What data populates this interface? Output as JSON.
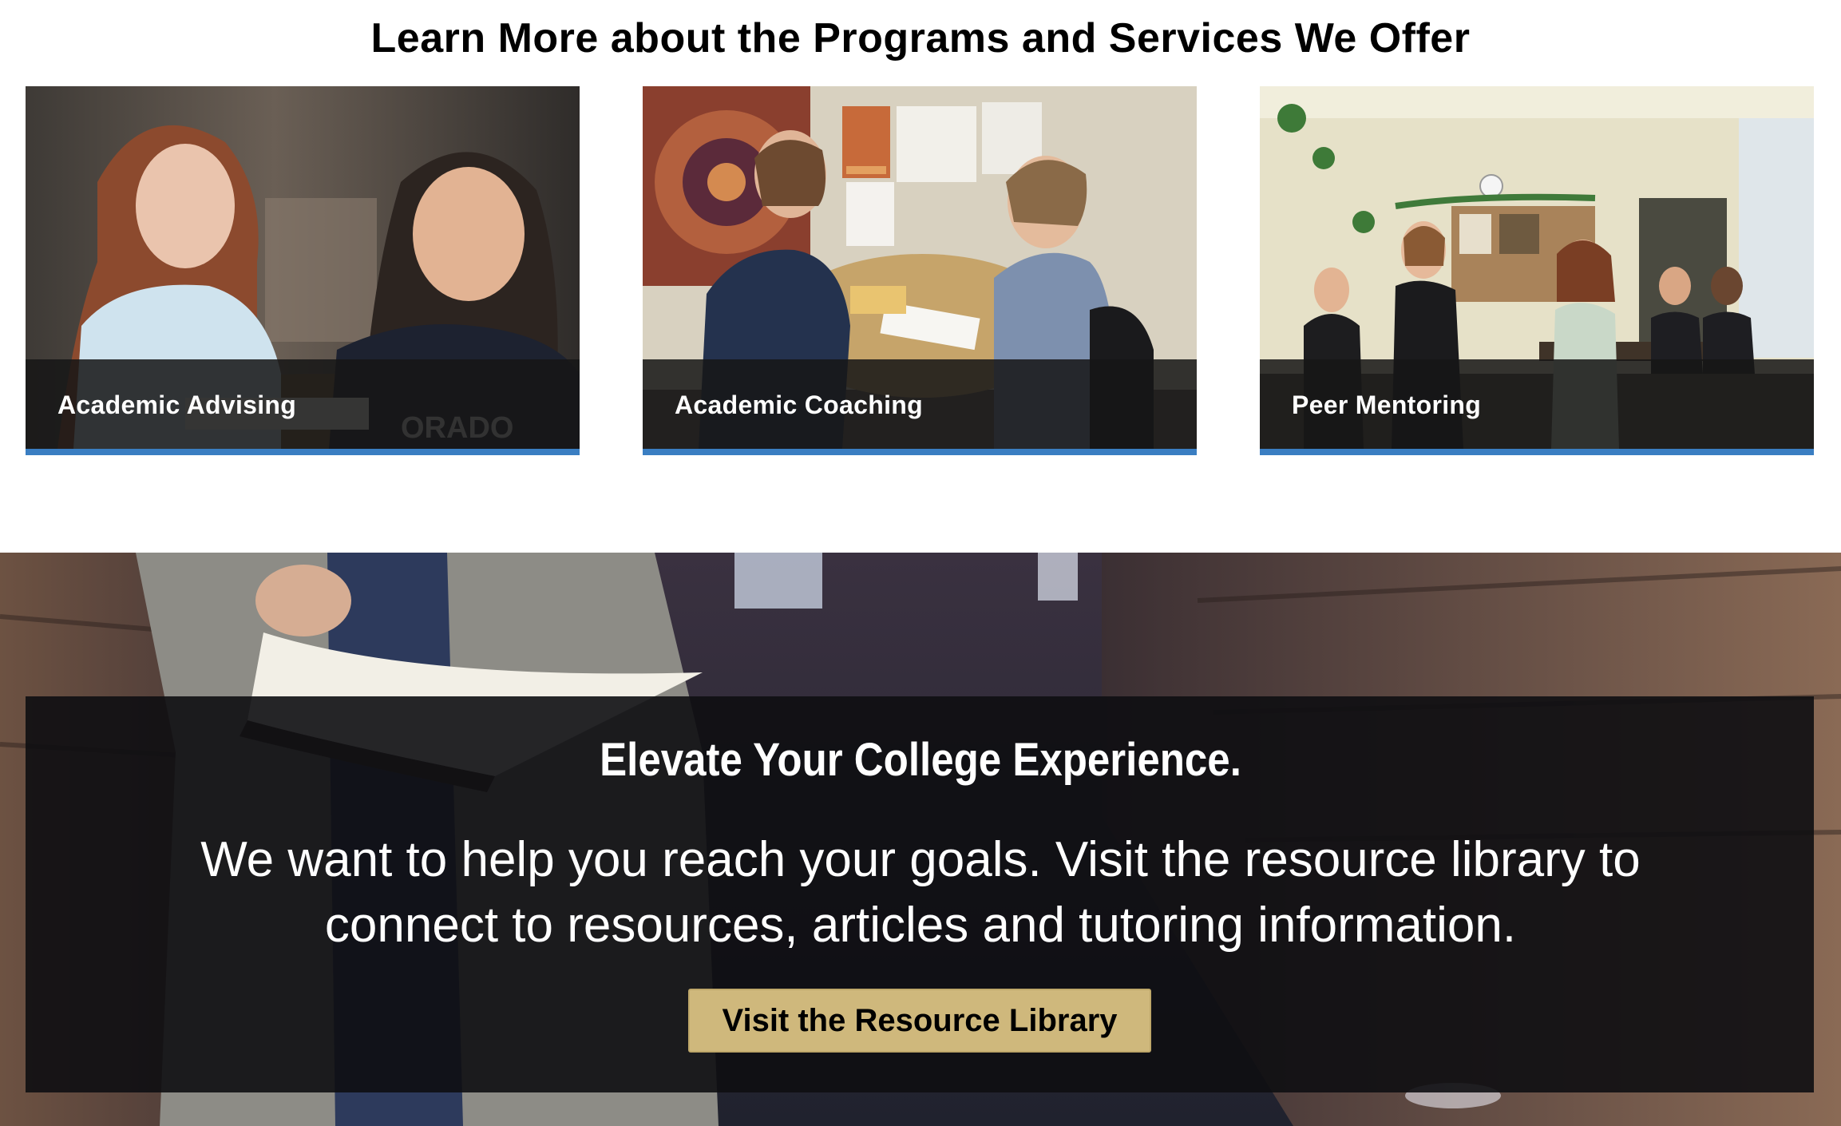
{
  "programs": {
    "heading": "Learn More about the Programs and Services We Offer",
    "accent_color": "#3a7ec2",
    "cards": [
      {
        "label": "Academic Advising",
        "image": "two students reviewing papers at a table"
      },
      {
        "label": "Academic Coaching",
        "image": "coach and student meeting at a round table"
      },
      {
        "label": "Peer Mentoring",
        "image": "students gathered in a mentoring lounge"
      }
    ]
  },
  "hero": {
    "heading": "Elevate Your College Experience.",
    "body": "We want to help you reach your goals. Visit the resource library to connect to resources, articles and tutoring information.",
    "button_label": "Visit the Resource Library",
    "button_color": "#cfb87c",
    "background_image": "student reading a book in a library aisle"
  }
}
